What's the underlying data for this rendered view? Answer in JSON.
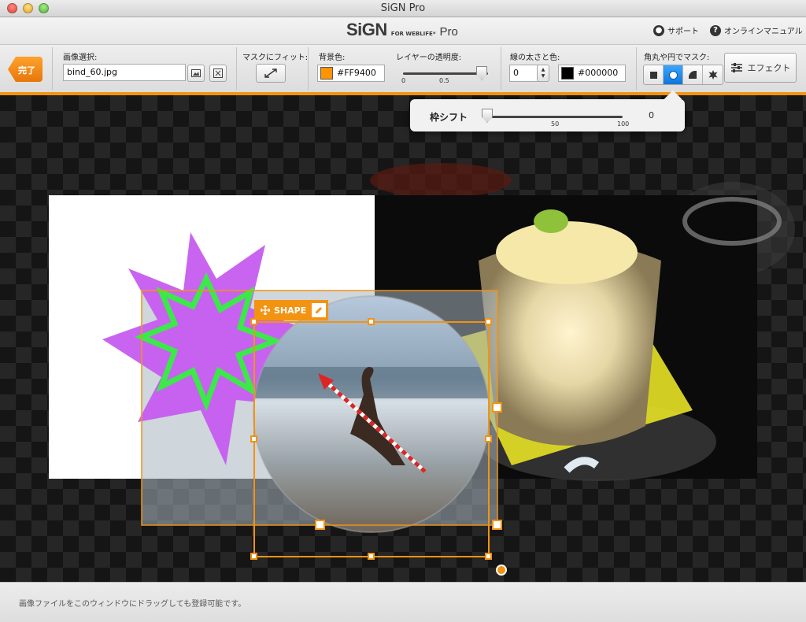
{
  "window": {
    "title": "SiGN Pro"
  },
  "header": {
    "brand_logo": "SiGN",
    "brand_sub": "FOR WEBLIFE*",
    "brand_pro": "Pro",
    "support_label": "サポート",
    "manual_label": "オンラインマニュアル"
  },
  "toolbar": {
    "done_label": "完了",
    "image_select_label": "画像選択:",
    "image_file": "bind_60.jpg",
    "mask_fit_label": "マスクにフィット:",
    "bg_color_label": "背景色:",
    "bg_color_value": "#FF9400",
    "bg_color_hex": "#FF9400",
    "opacity_label": "レイヤーの透明度:",
    "opacity_value": 1.0,
    "opacity_tick_min": "0",
    "opacity_tick_mid": "0.5",
    "border_label": "線の太さと色:",
    "border_width": "0",
    "border_color_value": "#000000",
    "border_color_hex": "#000000",
    "mask_label": "角丸や円でマスク:",
    "mask_selected": "circle",
    "effect_label": "エフェクト"
  },
  "popover": {
    "frame_shift_label": "枠シフト",
    "frame_shift_value": "0",
    "tick_50": "50",
    "tick_100": "100"
  },
  "canvas": {
    "shape_tag_label": "SHAPE"
  },
  "status": {
    "hint": "画像ファイルをこのウィンドウにドラッグしても登録可能です。"
  },
  "colors": {
    "accent": "#F29312",
    "star_purple": "#C65CF0",
    "star_green": "#3CE84A"
  }
}
